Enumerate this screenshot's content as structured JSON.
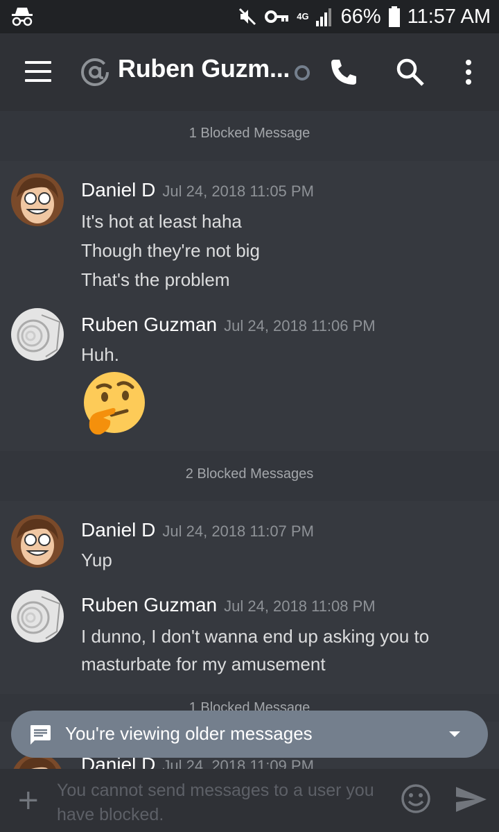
{
  "status_bar": {
    "network": "4G",
    "battery": "66%",
    "time": "11:57 AM"
  },
  "header": {
    "title": "Ruben Guzm..."
  },
  "messages": [
    {
      "type": "blocked",
      "text": "1 Blocked Message"
    },
    {
      "type": "message",
      "author": "Daniel D",
      "timestamp": "Jul 24, 2018 11:05 PM",
      "lines": [
        "It's hot at least haha",
        "Though they're not big",
        "That's the problem"
      ]
    },
    {
      "type": "message",
      "author": "Ruben Guzman",
      "timestamp": "Jul 24, 2018 11:06 PM",
      "lines": [
        "Huh."
      ],
      "emoji": "thinking-face"
    },
    {
      "type": "blocked",
      "text": "2 Blocked Messages"
    },
    {
      "type": "message",
      "author": "Daniel D",
      "timestamp": "Jul 24, 2018 11:07 PM",
      "lines": [
        "Yup"
      ]
    },
    {
      "type": "message",
      "author": "Ruben Guzman",
      "timestamp": "Jul 24, 2018 11:08 PM",
      "lines": [
        "I dunno, I don't wanna end up asking you to",
        "masturbate for my amusement"
      ]
    },
    {
      "type": "blocked",
      "text": "1 Blocked Message"
    },
    {
      "type": "message",
      "author": "Daniel D",
      "timestamp": "Jul 24, 2018 11:09 PM",
      "lines": []
    }
  ],
  "banner": {
    "text": "You're viewing older messages"
  },
  "input": {
    "placeholder": "You cannot send messages to a user you have blocked."
  },
  "colors": {
    "background": "#36393f",
    "header": "#2f3136",
    "status_bar": "#202225",
    "banner": "#747f8d",
    "username": "#ffffff",
    "timestamp": "#8e9297"
  }
}
